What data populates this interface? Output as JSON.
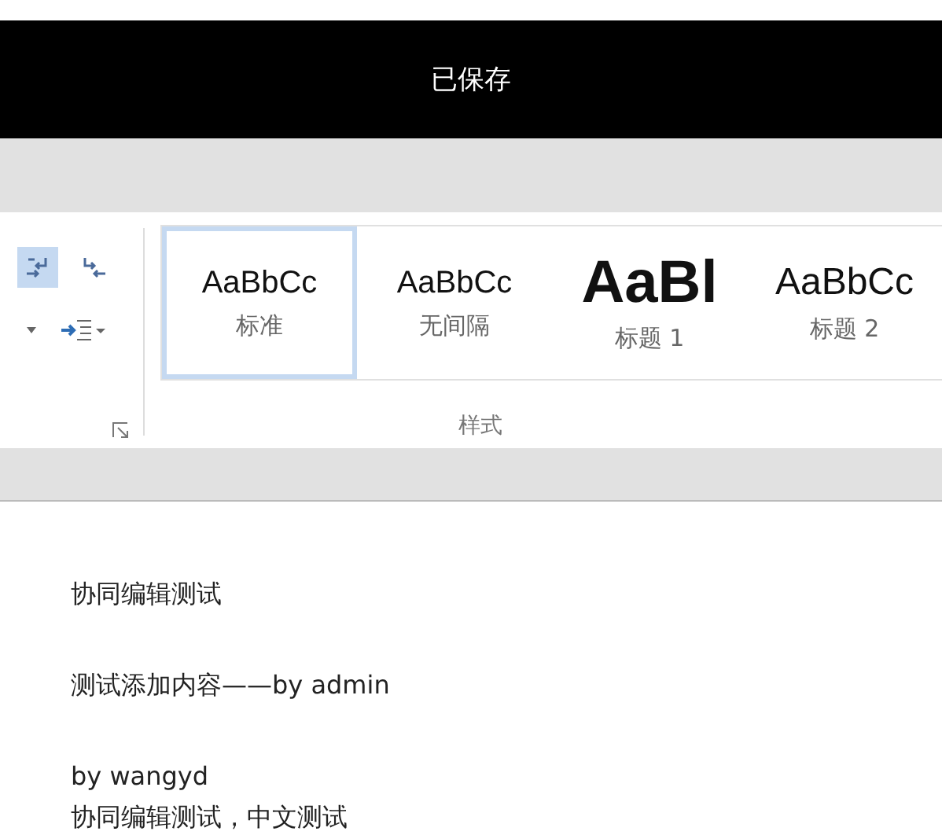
{
  "title_bar": {
    "title": "已保存"
  },
  "ribbon": {
    "styles": [
      {
        "preview": "AaBbCc",
        "label": "标准",
        "kind": "normal",
        "selected": true
      },
      {
        "preview": "AaBbCc",
        "label": "无间隔",
        "kind": "normal",
        "selected": false
      },
      {
        "preview": "AaBl",
        "label": "标题 1",
        "kind": "heading1",
        "selected": false
      },
      {
        "preview": "AaBbCc",
        "label": "标题 2",
        "kind": "heading2",
        "selected": false
      }
    ],
    "group_label": "样式"
  },
  "document": {
    "blocks": [
      {
        "lines": [
          "协同编辑测试"
        ]
      },
      {
        "lines": [
          "测试添加内容——by admin"
        ]
      },
      {
        "lines": [
          "by wangyd",
          "协同编辑测试，中文测试"
        ]
      }
    ]
  }
}
